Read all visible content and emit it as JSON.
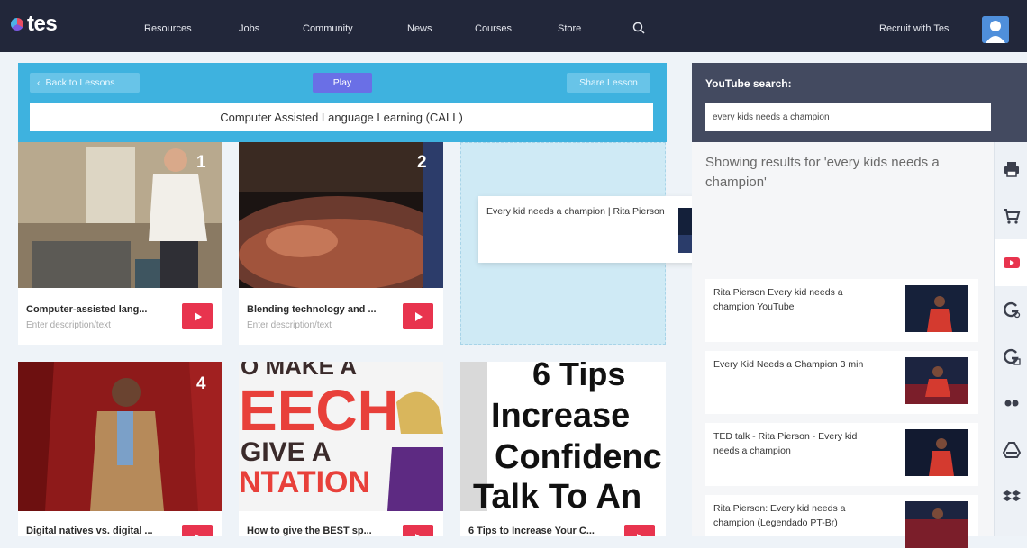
{
  "app": {
    "logo_text": "tes"
  },
  "nav": {
    "links": [
      "Resources",
      "Jobs",
      "Community",
      "News",
      "Courses",
      "Store"
    ],
    "recruit_label": "Recruit with Tes"
  },
  "lesson": {
    "back_label": "Back to Lessons",
    "play_label": "Play",
    "share_label": "Share Lesson",
    "title": "Computer Assisted Language Learning (CALL)"
  },
  "cards": [
    {
      "number": "1",
      "title": "Computer-assisted lang...",
      "desc": "Enter description/text"
    },
    {
      "number": "2",
      "title": "Blending technology and ...",
      "desc": "Enter description/text"
    },
    {
      "number": "4",
      "title": "Digital natives vs. digital ...",
      "desc": ""
    },
    {
      "number": "",
      "title": "How to give the BEST sp...",
      "desc": "",
      "overlay": [
        "O MAKE A",
        "EECH",
        "GIVE A",
        "NTATION"
      ]
    },
    {
      "number": "",
      "title": "6 Tips to Increase Your C...",
      "desc": "",
      "overlay": [
        "6 Tips",
        "Increase",
        "Confidenc",
        "Talk To An"
      ]
    }
  ],
  "dragging": {
    "title": "Every kid needs a champion | Rita Pierson"
  },
  "youtube": {
    "label": "YouTube search:",
    "query": "every kids needs a champion",
    "results_heading": "Showing results for 'every kids needs a champion'",
    "results": [
      "Rita Pierson Every kid needs a champion YouTube",
      "Every Kid Needs a Champion 3 min",
      "TED talk - Rita Pierson - Every kid needs a champion",
      "Rita Pierson: Every kid needs a champion (Legendado PT-Br)"
    ]
  },
  "side_icons": [
    "print-icon",
    "cart-icon",
    "youtube-icon",
    "google-search-icon",
    "google-drive-icon",
    "flickr-icon",
    "drive-icon",
    "dropbox-icon"
  ],
  "colors": {
    "nav_bg": "#22273a",
    "lesson_header": "#3eb2df",
    "play_button": "#6a6fe6",
    "youtube_red": "#e8344e",
    "panel_header": "#434a60"
  }
}
